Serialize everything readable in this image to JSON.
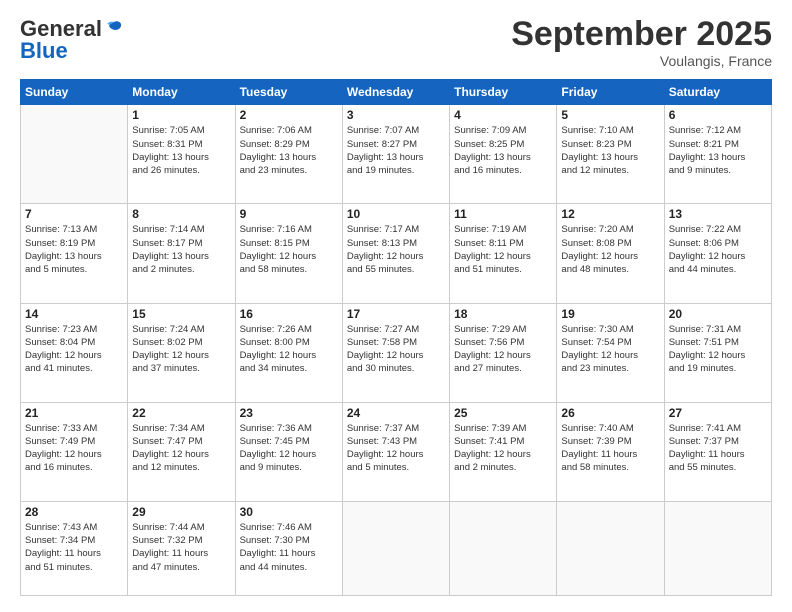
{
  "header": {
    "logo_general": "General",
    "logo_blue": "Blue",
    "month": "September 2025",
    "location": "Voulangis, France"
  },
  "days_of_week": [
    "Sunday",
    "Monday",
    "Tuesday",
    "Wednesday",
    "Thursday",
    "Friday",
    "Saturday"
  ],
  "weeks": [
    [
      {
        "day": "",
        "info": ""
      },
      {
        "day": "1",
        "info": "Sunrise: 7:05 AM\nSunset: 8:31 PM\nDaylight: 13 hours\nand 26 minutes."
      },
      {
        "day": "2",
        "info": "Sunrise: 7:06 AM\nSunset: 8:29 PM\nDaylight: 13 hours\nand 23 minutes."
      },
      {
        "day": "3",
        "info": "Sunrise: 7:07 AM\nSunset: 8:27 PM\nDaylight: 13 hours\nand 19 minutes."
      },
      {
        "day": "4",
        "info": "Sunrise: 7:09 AM\nSunset: 8:25 PM\nDaylight: 13 hours\nand 16 minutes."
      },
      {
        "day": "5",
        "info": "Sunrise: 7:10 AM\nSunset: 8:23 PM\nDaylight: 13 hours\nand 12 minutes."
      },
      {
        "day": "6",
        "info": "Sunrise: 7:12 AM\nSunset: 8:21 PM\nDaylight: 13 hours\nand 9 minutes."
      }
    ],
    [
      {
        "day": "7",
        "info": "Sunrise: 7:13 AM\nSunset: 8:19 PM\nDaylight: 13 hours\nand 5 minutes."
      },
      {
        "day": "8",
        "info": "Sunrise: 7:14 AM\nSunset: 8:17 PM\nDaylight: 13 hours\nand 2 minutes."
      },
      {
        "day": "9",
        "info": "Sunrise: 7:16 AM\nSunset: 8:15 PM\nDaylight: 12 hours\nand 58 minutes."
      },
      {
        "day": "10",
        "info": "Sunrise: 7:17 AM\nSunset: 8:13 PM\nDaylight: 12 hours\nand 55 minutes."
      },
      {
        "day": "11",
        "info": "Sunrise: 7:19 AM\nSunset: 8:11 PM\nDaylight: 12 hours\nand 51 minutes."
      },
      {
        "day": "12",
        "info": "Sunrise: 7:20 AM\nSunset: 8:08 PM\nDaylight: 12 hours\nand 48 minutes."
      },
      {
        "day": "13",
        "info": "Sunrise: 7:22 AM\nSunset: 8:06 PM\nDaylight: 12 hours\nand 44 minutes."
      }
    ],
    [
      {
        "day": "14",
        "info": "Sunrise: 7:23 AM\nSunset: 8:04 PM\nDaylight: 12 hours\nand 41 minutes."
      },
      {
        "day": "15",
        "info": "Sunrise: 7:24 AM\nSunset: 8:02 PM\nDaylight: 12 hours\nand 37 minutes."
      },
      {
        "day": "16",
        "info": "Sunrise: 7:26 AM\nSunset: 8:00 PM\nDaylight: 12 hours\nand 34 minutes."
      },
      {
        "day": "17",
        "info": "Sunrise: 7:27 AM\nSunset: 7:58 PM\nDaylight: 12 hours\nand 30 minutes."
      },
      {
        "day": "18",
        "info": "Sunrise: 7:29 AM\nSunset: 7:56 PM\nDaylight: 12 hours\nand 27 minutes."
      },
      {
        "day": "19",
        "info": "Sunrise: 7:30 AM\nSunset: 7:54 PM\nDaylight: 12 hours\nand 23 minutes."
      },
      {
        "day": "20",
        "info": "Sunrise: 7:31 AM\nSunset: 7:51 PM\nDaylight: 12 hours\nand 19 minutes."
      }
    ],
    [
      {
        "day": "21",
        "info": "Sunrise: 7:33 AM\nSunset: 7:49 PM\nDaylight: 12 hours\nand 16 minutes."
      },
      {
        "day": "22",
        "info": "Sunrise: 7:34 AM\nSunset: 7:47 PM\nDaylight: 12 hours\nand 12 minutes."
      },
      {
        "day": "23",
        "info": "Sunrise: 7:36 AM\nSunset: 7:45 PM\nDaylight: 12 hours\nand 9 minutes."
      },
      {
        "day": "24",
        "info": "Sunrise: 7:37 AM\nSunset: 7:43 PM\nDaylight: 12 hours\nand 5 minutes."
      },
      {
        "day": "25",
        "info": "Sunrise: 7:39 AM\nSunset: 7:41 PM\nDaylight: 12 hours\nand 2 minutes."
      },
      {
        "day": "26",
        "info": "Sunrise: 7:40 AM\nSunset: 7:39 PM\nDaylight: 11 hours\nand 58 minutes."
      },
      {
        "day": "27",
        "info": "Sunrise: 7:41 AM\nSunset: 7:37 PM\nDaylight: 11 hours\nand 55 minutes."
      }
    ],
    [
      {
        "day": "28",
        "info": "Sunrise: 7:43 AM\nSunset: 7:34 PM\nDaylight: 11 hours\nand 51 minutes."
      },
      {
        "day": "29",
        "info": "Sunrise: 7:44 AM\nSunset: 7:32 PM\nDaylight: 11 hours\nand 47 minutes."
      },
      {
        "day": "30",
        "info": "Sunrise: 7:46 AM\nSunset: 7:30 PM\nDaylight: 11 hours\nand 44 minutes."
      },
      {
        "day": "",
        "info": ""
      },
      {
        "day": "",
        "info": ""
      },
      {
        "day": "",
        "info": ""
      },
      {
        "day": "",
        "info": ""
      }
    ]
  ]
}
